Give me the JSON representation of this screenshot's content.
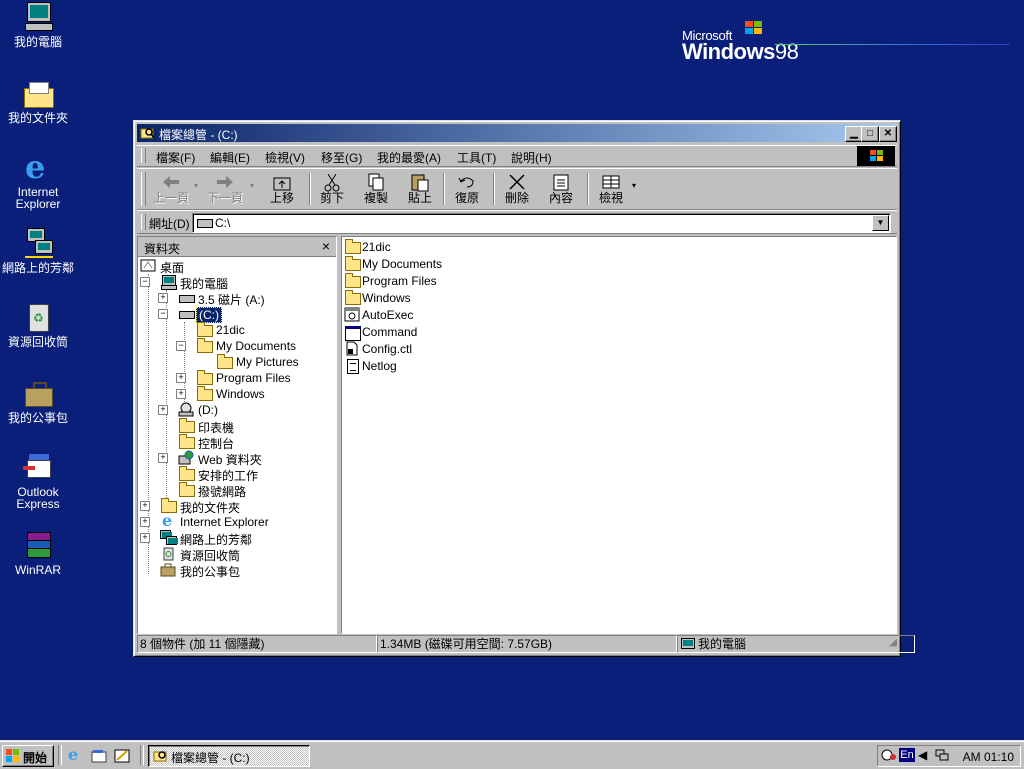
{
  "desktop": {
    "icons": [
      {
        "label": "我的電腦"
      },
      {
        "label": "我的文件夾"
      },
      {
        "label": "Internet\nExplorer"
      },
      {
        "label": "網路上的芳鄰"
      },
      {
        "label": "資源回收筒"
      },
      {
        "label": "我的公事包"
      },
      {
        "label": "Outlook\nExpress"
      },
      {
        "label": "WinRAR"
      }
    ],
    "brand": {
      "microsoft": "Microsoft",
      "windows": "Windows",
      "version": "98"
    }
  },
  "window": {
    "title": "檔案總管 - (C:)",
    "menu": [
      "檔案(F)",
      "編輯(E)",
      "檢視(V)",
      "移至(G)",
      "我的最愛(A)",
      "工具(T)",
      "說明(H)"
    ],
    "toolbar": {
      "back": "上一頁",
      "forward": "下一頁",
      "up": "上移",
      "cut": "剪下",
      "copy": "複製",
      "paste": "貼上",
      "undo": "復原",
      "delete": "刪除",
      "properties": "內容",
      "views": "檢視"
    },
    "address": {
      "label": "網址(D)",
      "value": "C:\\"
    },
    "folders_pane": {
      "title": "資料夾",
      "close": "×",
      "tree": {
        "desktop": "桌面",
        "my_computer": "我的電腦",
        "floppy": "3.5 磁片 (A:)",
        "c_drive": "(C:)",
        "c_21dic": "21dic",
        "c_mydocs": "My Documents",
        "c_mypics": "My Pictures",
        "c_progfiles": "Program Files",
        "c_windows": "Windows",
        "d_drive": "(D:)",
        "printers": "印表機",
        "control_panel": "控制台",
        "web_folders": "Web 資料夾",
        "scheduled": "安排的工作",
        "dialup": "撥號網路",
        "my_docs_folder": "我的文件夾",
        "ie": "Internet Explorer",
        "network": "網路上的芳鄰",
        "recycle": "資源回收筒",
        "briefcase": "我的公事包"
      }
    },
    "files": [
      {
        "name": "21dic",
        "type": "folder"
      },
      {
        "name": "My Documents",
        "type": "folder"
      },
      {
        "name": "Program Files",
        "type": "folder"
      },
      {
        "name": "Windows",
        "type": "folder"
      },
      {
        "name": "AutoExec",
        "type": "batch"
      },
      {
        "name": "Command",
        "type": "program"
      },
      {
        "name": "Config.ctl",
        "type": "file"
      },
      {
        "name": "Netlog",
        "type": "text"
      }
    ],
    "status": {
      "objects": "8 個物件 (加 11 個隱藏)",
      "size": "1.34MB (磁碟可用空間: 7.57GB)",
      "location": "我的電腦"
    }
  },
  "taskbar": {
    "start": "開始",
    "task": "檔案總管 - (C:)",
    "lang": "En",
    "clock": "AM 01:10"
  },
  "colors": {
    "desktop": "#0a1f7a",
    "titlebar_start": "#0a246a",
    "titlebar_end": "#a6caf0",
    "chrome": "#c0c0c0"
  }
}
